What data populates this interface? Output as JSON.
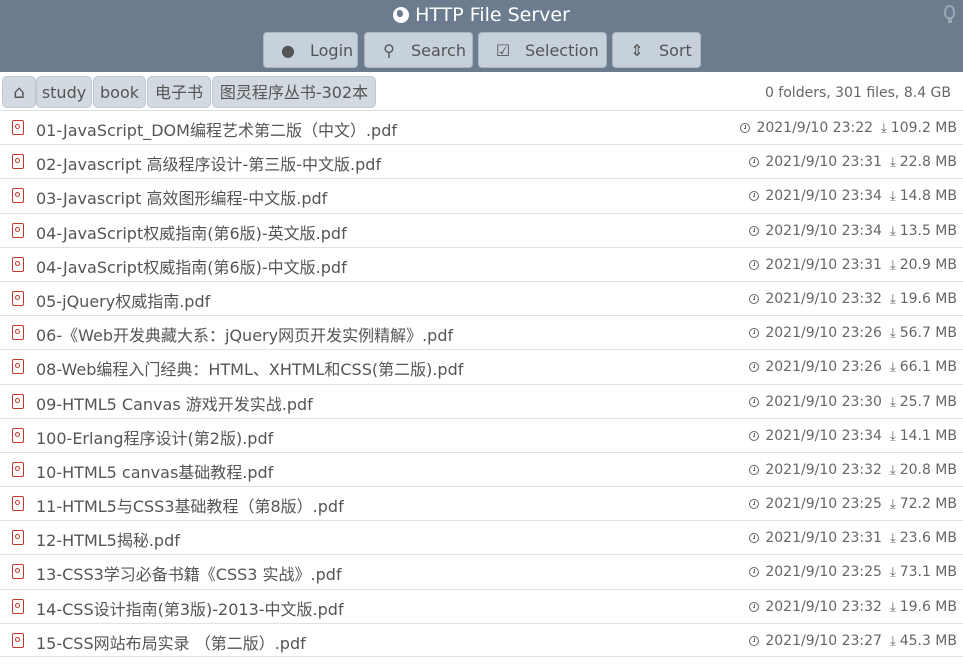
{
  "header": {
    "title": "HTTP File Server",
    "buttons": {
      "login": "Login",
      "search": "Search",
      "selection": "Selection",
      "sort": "Sort"
    }
  },
  "breadcrumb": [
    "study",
    "book",
    "电子书",
    "图灵程序丛书-302本"
  ],
  "stats": "0 folders, 301 files, 8.4 GB",
  "files": [
    {
      "name": "01-JavaScript_DOM编程艺术第二版（中文）.pdf",
      "date": "2021/9/10 23:22",
      "size": "109.2 MB"
    },
    {
      "name": "02-Javascript 高级程序设计-第三版-中文版.pdf",
      "date": "2021/9/10 23:31",
      "size": "22.8 MB"
    },
    {
      "name": "03-Javascript 高效图形编程-中文版.pdf",
      "date": "2021/9/10 23:34",
      "size": "14.8 MB"
    },
    {
      "name": "04-JavaScript权威指南(第6版)-英文版.pdf",
      "date": "2021/9/10 23:34",
      "size": "13.5 MB"
    },
    {
      "name": "04-JavaScript权威指南(第6版)-中文版.pdf",
      "date": "2021/9/10 23:31",
      "size": "20.9 MB"
    },
    {
      "name": "05-jQuery权威指南.pdf",
      "date": "2021/9/10 23:32",
      "size": "19.6 MB"
    },
    {
      "name": "06-《Web开发典藏大系：jQuery网页开发实例精解》.pdf",
      "date": "2021/9/10 23:26",
      "size": "56.7 MB"
    },
    {
      "name": "08-Web编程入门经典：HTML、XHTML和CSS(第二版).pdf",
      "date": "2021/9/10 23:26",
      "size": "66.1 MB"
    },
    {
      "name": "09-HTML5 Canvas 游戏开发实战.pdf",
      "date": "2021/9/10 23:30",
      "size": "25.7 MB"
    },
    {
      "name": "100-Erlang程序设计(第2版).pdf",
      "date": "2021/9/10 23:34",
      "size": "14.1 MB"
    },
    {
      "name": "10-HTML5 canvas基础教程.pdf",
      "date": "2021/9/10 23:32",
      "size": "20.8 MB"
    },
    {
      "name": "11-HTML5与CSS3基础教程（第8版）.pdf",
      "date": "2021/9/10 23:25",
      "size": "72.2 MB"
    },
    {
      "name": "12-HTML5揭秘.pdf",
      "date": "2021/9/10 23:31",
      "size": "23.6 MB"
    },
    {
      "name": "13-CSS3学习必备书籍《CSS3 实战》.pdf",
      "date": "2021/9/10 23:25",
      "size": "73.1 MB"
    },
    {
      "name": "14-CSS设计指南(第3版)-2013-中文版.pdf",
      "date": "2021/9/10 23:32",
      "size": "19.6 MB"
    },
    {
      "name": "15-CSS网站布局实录 （第二版）.pdf",
      "date": "2021/9/10 23:27",
      "size": "45.3 MB"
    }
  ]
}
